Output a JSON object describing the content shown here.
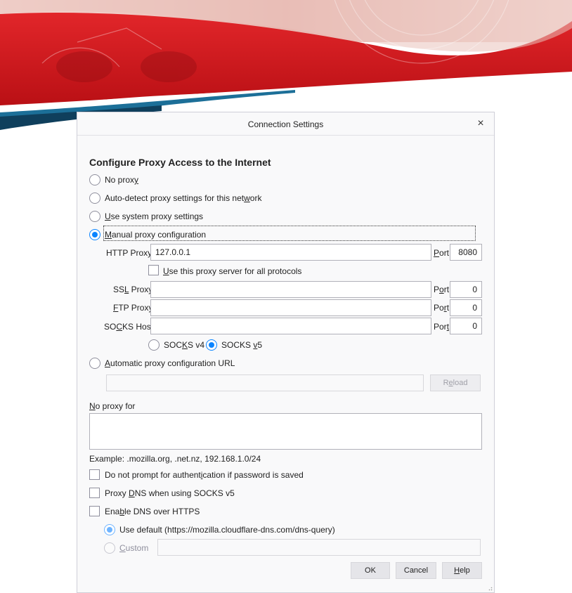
{
  "dialog": {
    "title": "Connection Settings",
    "close_glyph": "×"
  },
  "section_heading": "Configure Proxy Access to the Internet",
  "proxy_mode": {
    "no_proxy": {
      "pre": "No prox",
      "key": "y",
      "post": "",
      "selected": false
    },
    "auto_detect": {
      "pre": "Auto-detect proxy settings for this net",
      "key": "w",
      "post": "ork",
      "selected": false
    },
    "system": {
      "pre": "",
      "key": "U",
      "post": "se system proxy settings",
      "selected": false
    },
    "manual": {
      "pre": "",
      "key": "M",
      "post": "anual proxy configuration",
      "selected": true
    },
    "auto_url": {
      "pre": "",
      "key": "A",
      "post": "utomatic proxy configuration URL",
      "selected": false
    }
  },
  "http": {
    "label_pre": "HTTP Prox",
    "label_key": "y",
    "label_post": "",
    "value": "127.0.0.1",
    "port_pre": "",
    "port_key": "P",
    "port_post": "ort",
    "port_value": "8080"
  },
  "share_all": {
    "pre": "",
    "key": "U",
    "post": "se this proxy server for all protocols",
    "checked": false
  },
  "ssl": {
    "label_pre": "SS",
    "label_key": "L",
    "label_post": " Proxy",
    "value": "",
    "port_pre": "P",
    "port_key": "o",
    "port_post": "rt",
    "port_value": "0"
  },
  "ftp": {
    "label_pre": "",
    "label_key": "F",
    "label_post": "TP Proxy",
    "value": "",
    "port_pre": "Po",
    "port_key": "r",
    "port_post": "t",
    "port_value": "0"
  },
  "socks": {
    "label_pre": "SO",
    "label_key": "C",
    "label_post": "KS Host",
    "value": "",
    "port_pre": "Por",
    "port_key": "t",
    "port_post": "",
    "port_value": "0",
    "v4": {
      "pre": "SOC",
      "key": "K",
      "post": "S v4",
      "selected": false
    },
    "v5": {
      "pre": "SOCKS ",
      "key": "v",
      "post": "5",
      "selected": true
    }
  },
  "auto_url_field": {
    "value": ""
  },
  "reload_button": {
    "pre": "R",
    "key": "e",
    "post": "load"
  },
  "no_proxy_for": {
    "pre": "",
    "key": "N",
    "post": "o proxy for",
    "value": ""
  },
  "example_text": "Example: .mozilla.org, .net.nz, 192.168.1.0/24",
  "options": {
    "no_auth_prompt": {
      "pre": "Do not prompt for authent",
      "key": "i",
      "post": "cation if password is saved",
      "checked": false
    },
    "proxy_dns": {
      "pre": "Proxy ",
      "key": "D",
      "post": "NS when using SOCKS v5",
      "checked": false
    },
    "dns_https": {
      "pre": "Ena",
      "key": "b",
      "post": "le DNS over HTTPS",
      "checked": false
    }
  },
  "doh": {
    "default": {
      "label": "Use default (https://mozilla.cloudflare-dns.com/dns-query)",
      "selected": true
    },
    "custom": {
      "pre": "",
      "key": "C",
      "post": "ustom",
      "selected": false
    },
    "custom_value": ""
  },
  "buttons": {
    "ok": "OK",
    "cancel": "Cancel",
    "help_pre": "",
    "help_key": "H",
    "help_post": "elp"
  },
  "colors": {
    "accent": "#0a84ff",
    "banner_red": "#d7131b",
    "banner_blue": "#1c6f98"
  }
}
